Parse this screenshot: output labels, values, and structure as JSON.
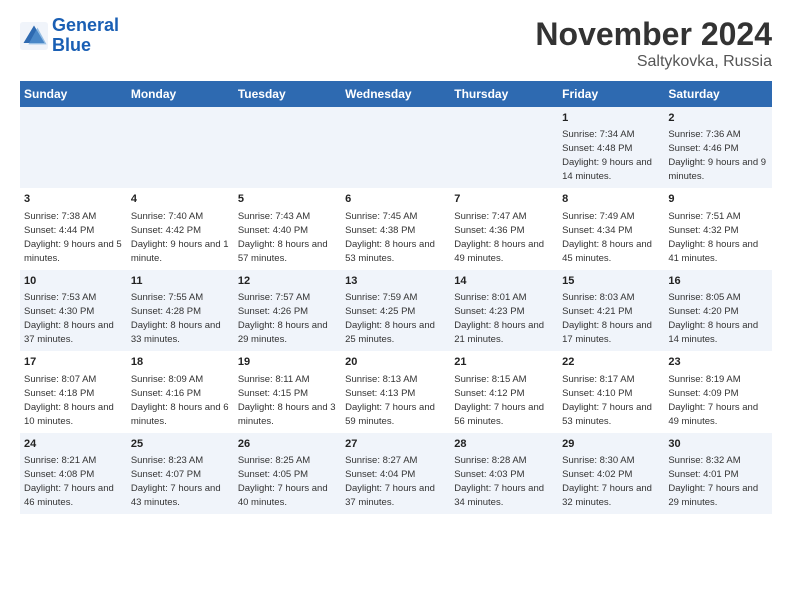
{
  "logo": {
    "line1": "General",
    "line2": "Blue"
  },
  "title": "November 2024",
  "subtitle": "Saltykovka, Russia",
  "days_of_week": [
    "Sunday",
    "Monday",
    "Tuesday",
    "Wednesday",
    "Thursday",
    "Friday",
    "Saturday"
  ],
  "weeks": [
    [
      {
        "day": "",
        "info": ""
      },
      {
        "day": "",
        "info": ""
      },
      {
        "day": "",
        "info": ""
      },
      {
        "day": "",
        "info": ""
      },
      {
        "day": "",
        "info": ""
      },
      {
        "day": "1",
        "info": "Sunrise: 7:34 AM\nSunset: 4:48 PM\nDaylight: 9 hours and 14 minutes."
      },
      {
        "day": "2",
        "info": "Sunrise: 7:36 AM\nSunset: 4:46 PM\nDaylight: 9 hours and 9 minutes."
      }
    ],
    [
      {
        "day": "3",
        "info": "Sunrise: 7:38 AM\nSunset: 4:44 PM\nDaylight: 9 hours and 5 minutes."
      },
      {
        "day": "4",
        "info": "Sunrise: 7:40 AM\nSunset: 4:42 PM\nDaylight: 9 hours and 1 minute."
      },
      {
        "day": "5",
        "info": "Sunrise: 7:43 AM\nSunset: 4:40 PM\nDaylight: 8 hours and 57 minutes."
      },
      {
        "day": "6",
        "info": "Sunrise: 7:45 AM\nSunset: 4:38 PM\nDaylight: 8 hours and 53 minutes."
      },
      {
        "day": "7",
        "info": "Sunrise: 7:47 AM\nSunset: 4:36 PM\nDaylight: 8 hours and 49 minutes."
      },
      {
        "day": "8",
        "info": "Sunrise: 7:49 AM\nSunset: 4:34 PM\nDaylight: 8 hours and 45 minutes."
      },
      {
        "day": "9",
        "info": "Sunrise: 7:51 AM\nSunset: 4:32 PM\nDaylight: 8 hours and 41 minutes."
      }
    ],
    [
      {
        "day": "10",
        "info": "Sunrise: 7:53 AM\nSunset: 4:30 PM\nDaylight: 8 hours and 37 minutes."
      },
      {
        "day": "11",
        "info": "Sunrise: 7:55 AM\nSunset: 4:28 PM\nDaylight: 8 hours and 33 minutes."
      },
      {
        "day": "12",
        "info": "Sunrise: 7:57 AM\nSunset: 4:26 PM\nDaylight: 8 hours and 29 minutes."
      },
      {
        "day": "13",
        "info": "Sunrise: 7:59 AM\nSunset: 4:25 PM\nDaylight: 8 hours and 25 minutes."
      },
      {
        "day": "14",
        "info": "Sunrise: 8:01 AM\nSunset: 4:23 PM\nDaylight: 8 hours and 21 minutes."
      },
      {
        "day": "15",
        "info": "Sunrise: 8:03 AM\nSunset: 4:21 PM\nDaylight: 8 hours and 17 minutes."
      },
      {
        "day": "16",
        "info": "Sunrise: 8:05 AM\nSunset: 4:20 PM\nDaylight: 8 hours and 14 minutes."
      }
    ],
    [
      {
        "day": "17",
        "info": "Sunrise: 8:07 AM\nSunset: 4:18 PM\nDaylight: 8 hours and 10 minutes."
      },
      {
        "day": "18",
        "info": "Sunrise: 8:09 AM\nSunset: 4:16 PM\nDaylight: 8 hours and 6 minutes."
      },
      {
        "day": "19",
        "info": "Sunrise: 8:11 AM\nSunset: 4:15 PM\nDaylight: 8 hours and 3 minutes."
      },
      {
        "day": "20",
        "info": "Sunrise: 8:13 AM\nSunset: 4:13 PM\nDaylight: 7 hours and 59 minutes."
      },
      {
        "day": "21",
        "info": "Sunrise: 8:15 AM\nSunset: 4:12 PM\nDaylight: 7 hours and 56 minutes."
      },
      {
        "day": "22",
        "info": "Sunrise: 8:17 AM\nSunset: 4:10 PM\nDaylight: 7 hours and 53 minutes."
      },
      {
        "day": "23",
        "info": "Sunrise: 8:19 AM\nSunset: 4:09 PM\nDaylight: 7 hours and 49 minutes."
      }
    ],
    [
      {
        "day": "24",
        "info": "Sunrise: 8:21 AM\nSunset: 4:08 PM\nDaylight: 7 hours and 46 minutes."
      },
      {
        "day": "25",
        "info": "Sunrise: 8:23 AM\nSunset: 4:07 PM\nDaylight: 7 hours and 43 minutes."
      },
      {
        "day": "26",
        "info": "Sunrise: 8:25 AM\nSunset: 4:05 PM\nDaylight: 7 hours and 40 minutes."
      },
      {
        "day": "27",
        "info": "Sunrise: 8:27 AM\nSunset: 4:04 PM\nDaylight: 7 hours and 37 minutes."
      },
      {
        "day": "28",
        "info": "Sunrise: 8:28 AM\nSunset: 4:03 PM\nDaylight: 7 hours and 34 minutes."
      },
      {
        "day": "29",
        "info": "Sunrise: 8:30 AM\nSunset: 4:02 PM\nDaylight: 7 hours and 32 minutes."
      },
      {
        "day": "30",
        "info": "Sunrise: 8:32 AM\nSunset: 4:01 PM\nDaylight: 7 hours and 29 minutes."
      }
    ]
  ]
}
